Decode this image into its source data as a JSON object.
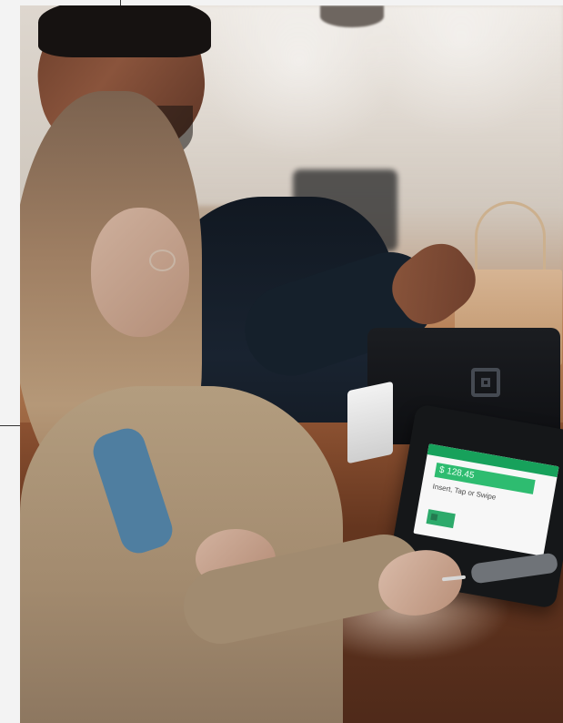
{
  "scene": {
    "type": "photo",
    "subject_terms": [
      "man",
      "woman",
      "payment terminal",
      "paper bag",
      "wooden counter"
    ]
  },
  "terminal": {
    "amount": "$ 128.45",
    "message": "Insert, Tap or Swipe"
  },
  "colors": {
    "accent": "#17a15b",
    "counter": "#6b3a22",
    "screen": "#f7f7f7"
  },
  "icons": {
    "stand_logo": "square-logo-icon",
    "screen_logo": "brand-logo-icon"
  }
}
